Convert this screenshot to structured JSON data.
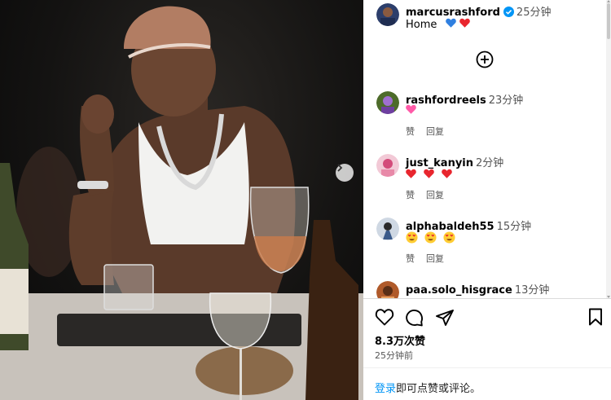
{
  "post": {
    "author": "marcusrashford",
    "time": "25分钟",
    "caption": "Home",
    "caption_emojis": [
      "blue-heart",
      "red-heart"
    ]
  },
  "comments": [
    {
      "user": "rashfordreels",
      "time": "23分钟",
      "emojis": [
        "pink-heart"
      ],
      "like_label": "赞",
      "reply_label": "回复"
    },
    {
      "user": "just_kanyin",
      "time": "2分钟",
      "emojis": [
        "red-heart",
        "red-heart",
        "red-heart"
      ],
      "like_label": "赞",
      "reply_label": "回复"
    },
    {
      "user": "alphabaldeh55",
      "time": "15分钟",
      "emojis": [
        "heart-eyes",
        "heart-eyes",
        "heart-eyes"
      ],
      "like_label": "赞",
      "reply_label": "回复"
    },
    {
      "user": "paa.solo_hisgrace",
      "time": "13分钟"
    }
  ],
  "footer": {
    "likes": "8.3万次赞",
    "posted": "25分钟前",
    "login_link": "登录",
    "login_rest": "即可点赞或评论。"
  },
  "colors": {
    "link": "#0095f6",
    "verified": "#0095f6",
    "heart_red": "#e8262e",
    "heart_blue": "#2f7fe0",
    "heart_pink": "#ff5aa8"
  },
  "icons": [
    "chevron-right-icon",
    "add-circle-icon",
    "heart-icon",
    "comment-icon",
    "share-icon",
    "bookmark-icon",
    "verified-badge-icon"
  ]
}
